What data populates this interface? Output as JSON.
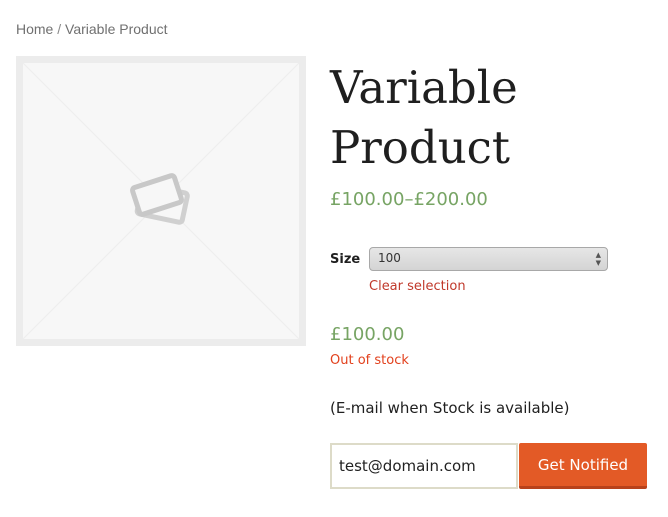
{
  "breadcrumb": {
    "home": "Home",
    "separator": " / ",
    "current": "Variable Product"
  },
  "product": {
    "title": "Variable Product",
    "price_range_low": "£100.00",
    "price_range_dash": "–",
    "price_range_high": "£200.00",
    "image_icon": "image-placeholder-icon"
  },
  "variation": {
    "size_label": "Size",
    "size_selected": "100",
    "clear_label": "Clear selection",
    "price": "£100.00",
    "stock_status": "Out of stock"
  },
  "notify": {
    "text": "(E-mail when Stock is available)",
    "email_value": "test@domain.com",
    "button_label": "Get Notified"
  },
  "colors": {
    "price": "#77a464",
    "out_of_stock": "#e2401c",
    "clear_link": "#c0392b",
    "button": "#e35a26"
  }
}
